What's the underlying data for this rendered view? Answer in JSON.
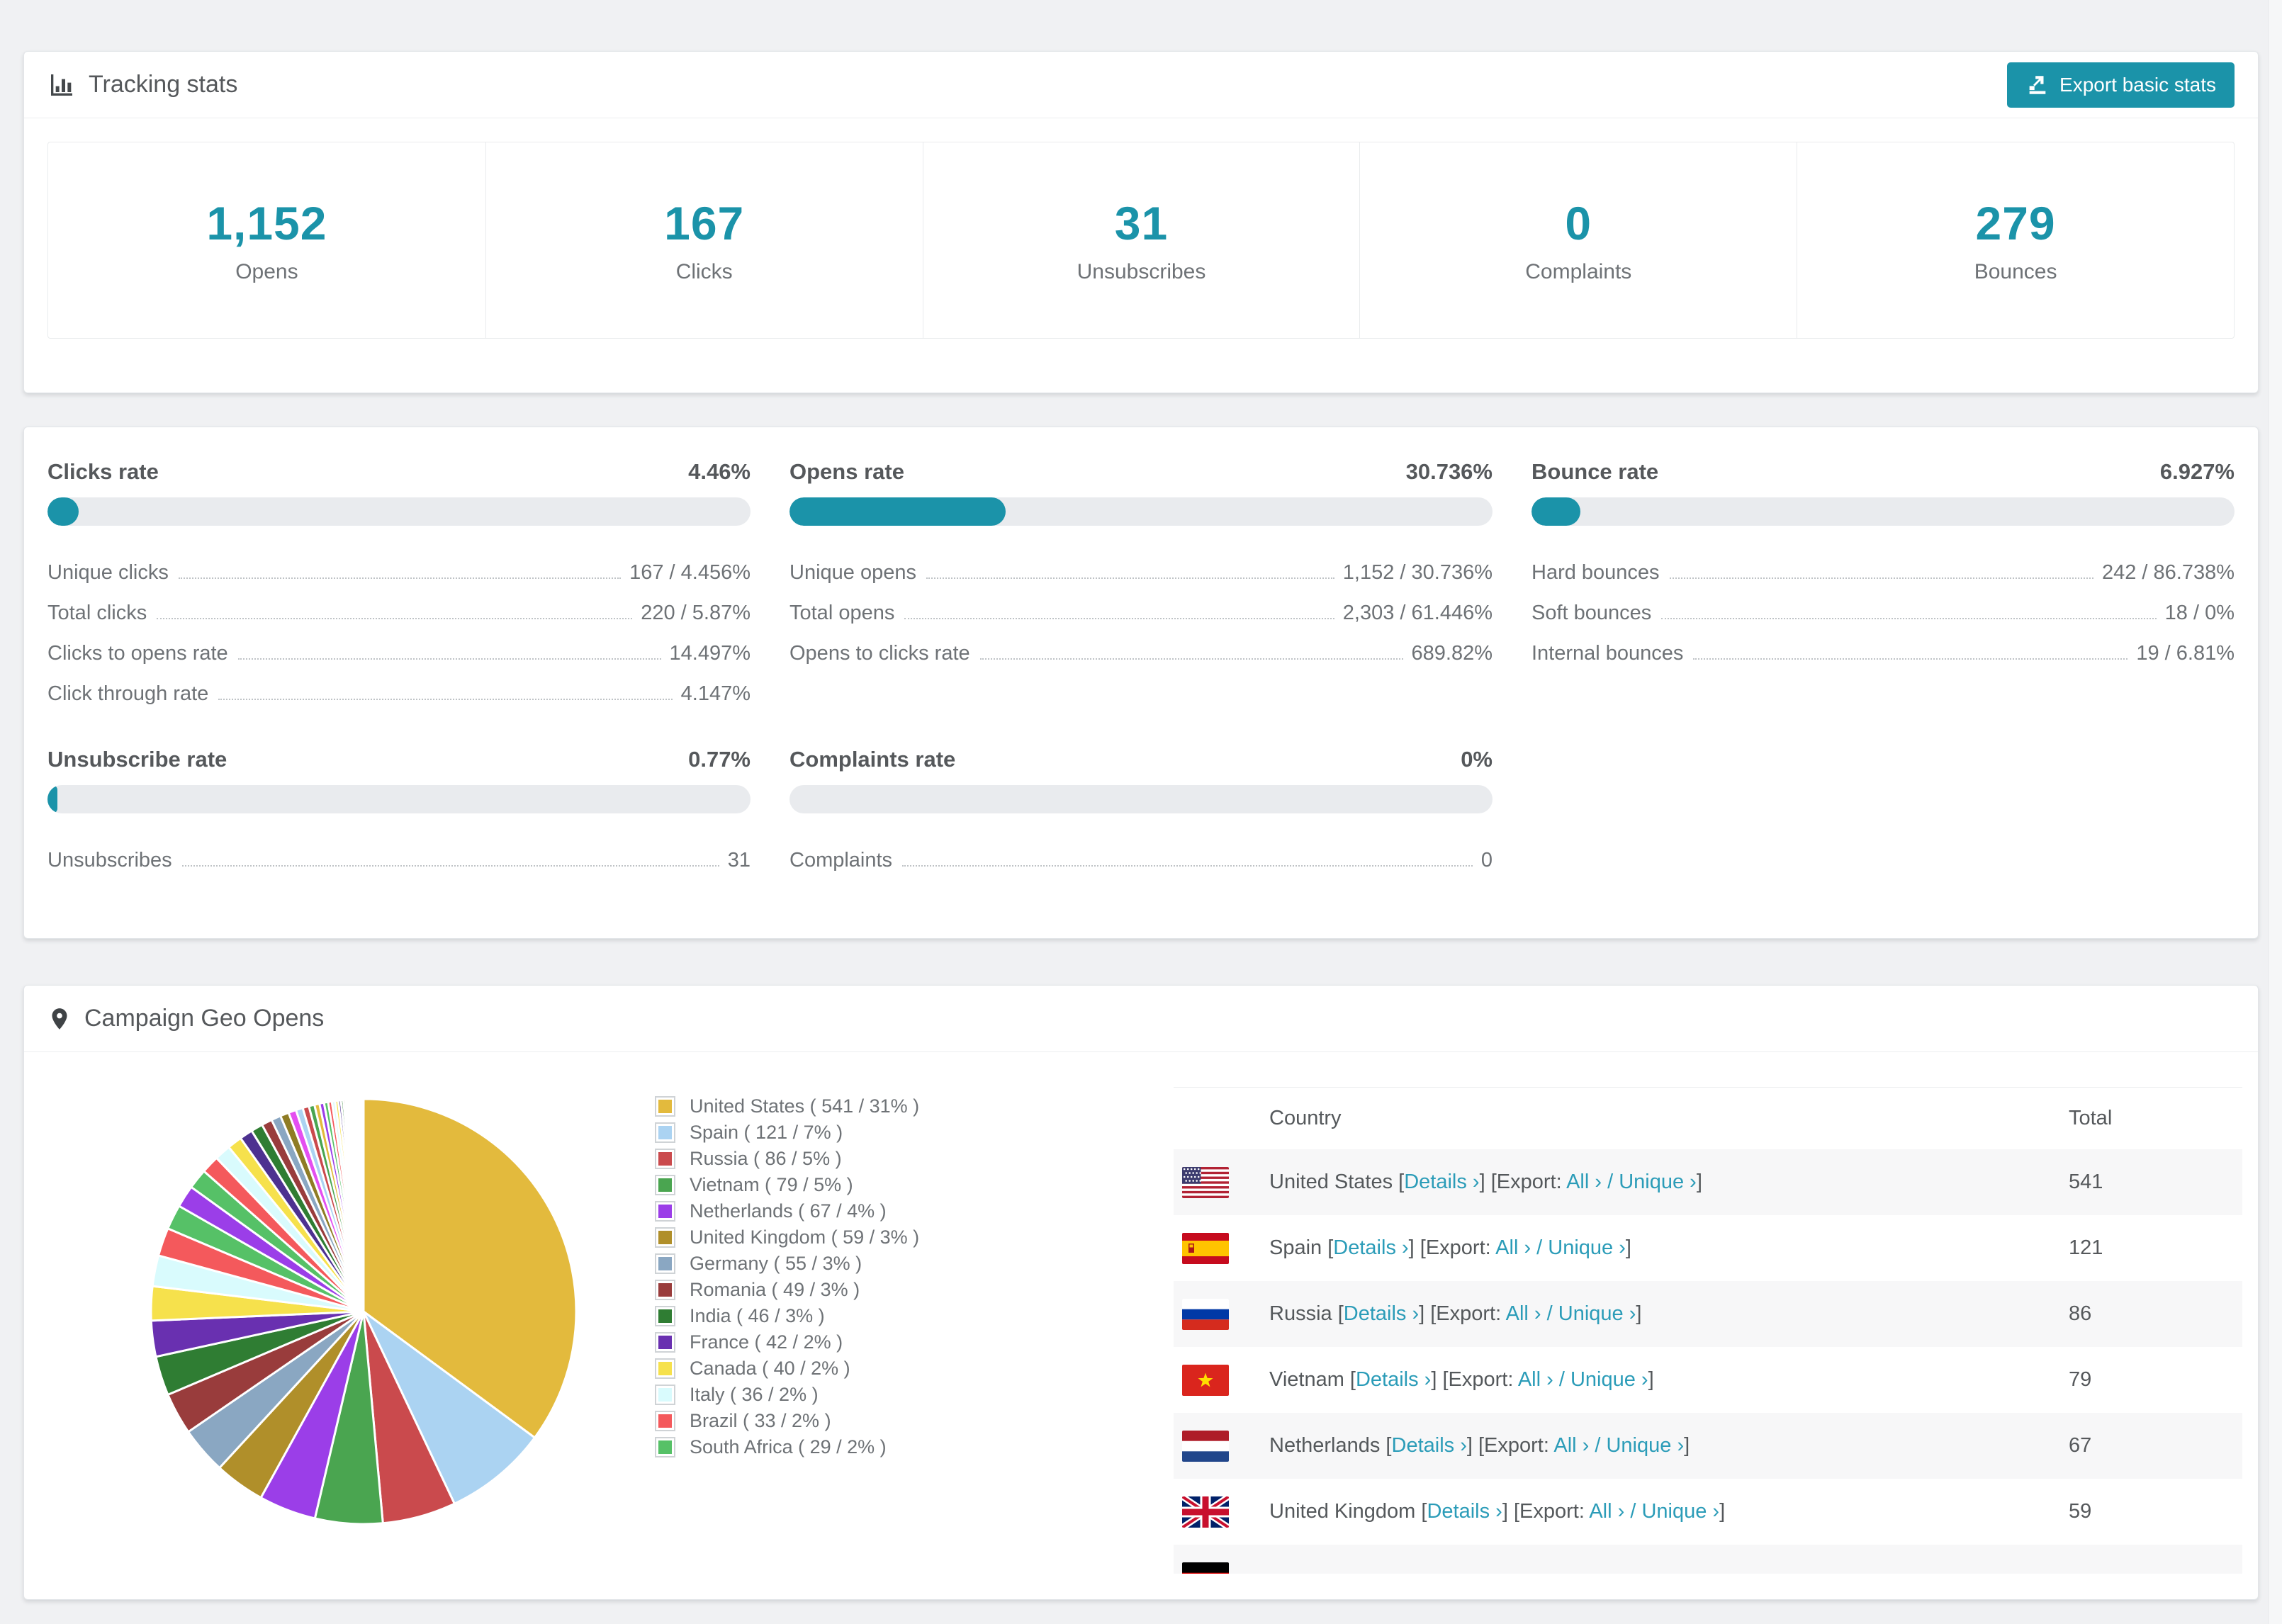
{
  "accent_color": "#1b93a9",
  "link_color": "#2b9cb8",
  "tracking": {
    "title": "Tracking stats",
    "export_button": "Export basic stats",
    "stats": [
      {
        "value": "1,152",
        "label": "Opens"
      },
      {
        "value": "167",
        "label": "Clicks"
      },
      {
        "value": "31",
        "label": "Unsubscribes"
      },
      {
        "value": "0",
        "label": "Complaints"
      },
      {
        "value": "279",
        "label": "Bounces"
      }
    ]
  },
  "rates": {
    "blocks": [
      {
        "title": "Clicks rate",
        "value": "4.46%",
        "percent": 4.46,
        "rows": [
          {
            "label": "Unique clicks",
            "value": "167 / 4.456%"
          },
          {
            "label": "Total clicks",
            "value": "220 / 5.87%"
          },
          {
            "label": "Clicks to opens rate",
            "value": "14.497%"
          },
          {
            "label": "Click through rate",
            "value": "4.147%"
          }
        ]
      },
      {
        "title": "Opens rate",
        "value": "30.736%",
        "percent": 30.736,
        "rows": [
          {
            "label": "Unique opens",
            "value": "1,152 / 30.736%"
          },
          {
            "label": "Total opens",
            "value": "2,303 / 61.446%"
          },
          {
            "label": "Opens to clicks rate",
            "value": "689.82%"
          }
        ]
      },
      {
        "title": "Bounce rate",
        "value": "6.927%",
        "percent": 6.927,
        "rows": [
          {
            "label": "Hard bounces",
            "value": "242 / 86.738%"
          },
          {
            "label": "Soft bounces",
            "value": "18 / 0%"
          },
          {
            "label": "Internal bounces",
            "value": "19 / 6.81%"
          }
        ]
      },
      {
        "title": "Unsubscribe rate",
        "value": "0.77%",
        "percent": 0.77,
        "rows": [
          {
            "label": "Unsubscribes",
            "value": "31"
          }
        ]
      },
      {
        "title": "Complaints rate",
        "value": "0%",
        "percent": 0,
        "rows": [
          {
            "label": "Complaints",
            "value": "0"
          }
        ]
      }
    ]
  },
  "geo": {
    "title": "Campaign Geo Opens",
    "legend_label_format": "{name} ( {value} / {pct}% )",
    "table": {
      "columns": [
        "Country",
        "Total"
      ],
      "links": {
        "details": "Details ›",
        "export_prefix": "[Export: ",
        "all": "All ›",
        "slash": " / ",
        "unique": "Unique ›",
        "open_bracket": " [",
        "close_bracket": "]"
      },
      "rows": [
        {
          "flag": "us",
          "country": "United States",
          "total": "541"
        },
        {
          "flag": "es",
          "country": "Spain",
          "total": "121"
        },
        {
          "flag": "ru",
          "country": "Russia",
          "total": "86"
        },
        {
          "flag": "vn",
          "country": "Vietnam",
          "total": "79"
        },
        {
          "flag": "nl",
          "country": "Netherlands",
          "total": "67"
        },
        {
          "flag": "gb",
          "country": "United Kingdom",
          "total": "59"
        },
        {
          "flag": "de",
          "country": "",
          "total": "",
          "partial": true
        }
      ]
    }
  },
  "chart_data": {
    "type": "pie",
    "title": "Campaign Geo Opens",
    "unit": "opens",
    "start_angle_deg": -90,
    "direction": "clockwise",
    "legend_position": "right",
    "series": [
      {
        "name": "United States",
        "value": 541,
        "pct": 31,
        "color": "#e3ba3d"
      },
      {
        "name": "Spain",
        "value": 121,
        "pct": 7,
        "color": "#abd3f2"
      },
      {
        "name": "Russia",
        "value": 86,
        "pct": 5,
        "color": "#ca4a4d"
      },
      {
        "name": "Vietnam",
        "value": 79,
        "pct": 5,
        "color": "#4aa550"
      },
      {
        "name": "Netherlands",
        "value": 67,
        "pct": 4,
        "color": "#9b3ee8"
      },
      {
        "name": "United Kingdom",
        "value": 59,
        "pct": 3,
        "color": "#b08f2a"
      },
      {
        "name": "Germany",
        "value": 55,
        "pct": 3,
        "color": "#8aa7c2"
      },
      {
        "name": "Romania",
        "value": 49,
        "pct": 3,
        "color": "#993c3c"
      },
      {
        "name": "India",
        "value": 46,
        "pct": 3,
        "color": "#2f7d33"
      },
      {
        "name": "France",
        "value": 42,
        "pct": 2,
        "color": "#6930b0"
      },
      {
        "name": "Canada",
        "value": 40,
        "pct": 2,
        "color": "#f6e14c"
      },
      {
        "name": "Italy",
        "value": 36,
        "pct": 2,
        "color": "#d9fbfd"
      },
      {
        "name": "Brazil",
        "value": 33,
        "pct": 2,
        "color": "#f4595c"
      },
      {
        "name": "South Africa",
        "value": 29,
        "pct": 2,
        "color": "#56c167"
      }
    ],
    "others_unlabeled": {
      "approx_slice_count": 44,
      "note": "many thin unlabeled slices, each under 2%"
    }
  }
}
